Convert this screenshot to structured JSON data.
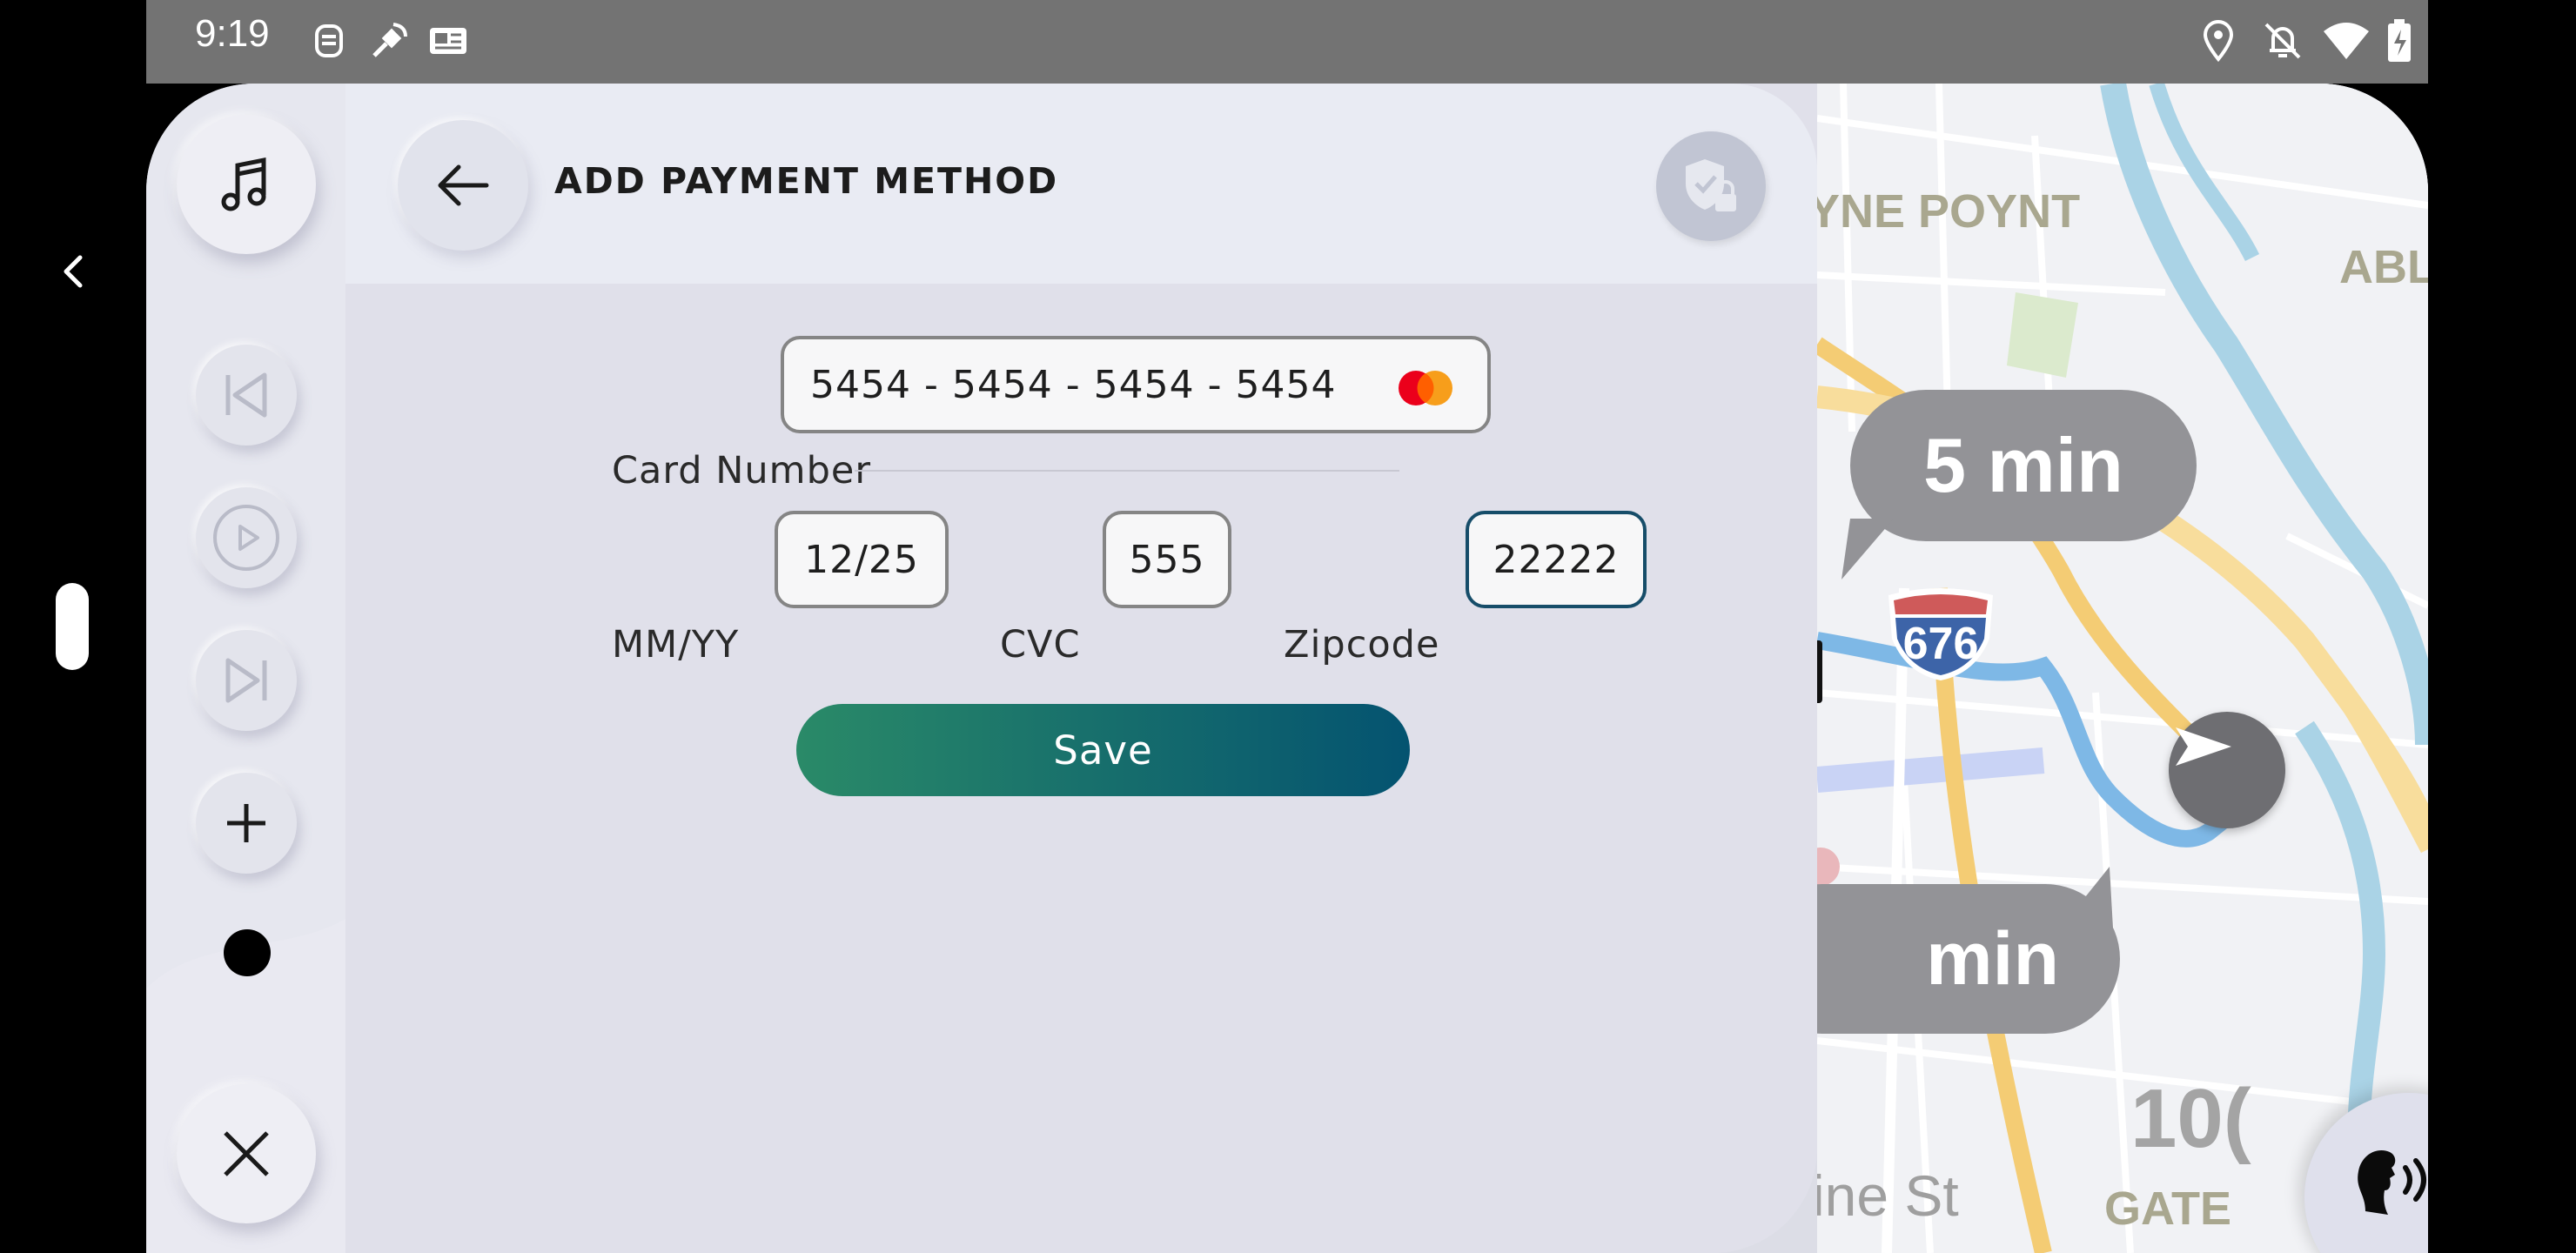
{
  "status_bar": {
    "time": "9:19",
    "left_icons": [
      "fan-icon",
      "satellite-icon",
      "news-icon"
    ],
    "right_icons": [
      "location-icon",
      "bell-off-icon",
      "wifi-icon",
      "battery-icon"
    ]
  },
  "media_rail": {
    "buttons": [
      "music-icon",
      "previous-icon",
      "play-icon",
      "next-icon",
      "add-icon",
      "dot-icon",
      "close-icon"
    ]
  },
  "header": {
    "title": "ADD PAYMENT METHOD",
    "back_icon": "arrow-left-icon",
    "action_icon": "shield-lock-icon"
  },
  "form": {
    "card_number_label": "Card Number",
    "card_number_value": "5454 - 5454 - 5454 - 5454",
    "card_brand_icon": "mastercard-icon",
    "expiry_label": "MM/YY",
    "expiry_value": "12/25",
    "cvc_label": "CVC",
    "cvc_value": "555",
    "zipcode_label": "Zipcode",
    "zipcode_value": "22222",
    "save_label": "Save"
  },
  "map": {
    "labels": [
      "YNE POYNT",
      "ABL",
      "GATE",
      "ine St",
      "10("
    ],
    "shield_number": "676",
    "eta_primary": "5 min",
    "eta_secondary": "min",
    "navigation_icon": "navigation-arrow-icon"
  },
  "voice": {
    "icon": "voice-speaking-icon"
  },
  "colors": {
    "status_bar": "#737373",
    "panel": "#e0e0ea",
    "save_gradient_start": "#2a8a68",
    "save_gradient_end": "#045370",
    "focused_border": "#164d69"
  }
}
